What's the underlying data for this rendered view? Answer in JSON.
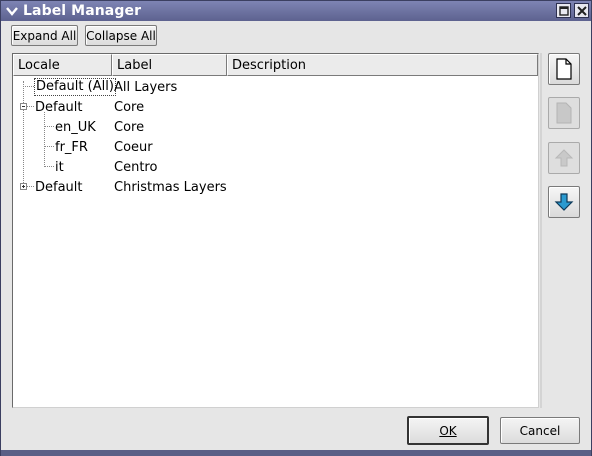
{
  "window": {
    "title": "Label Manager"
  },
  "toolbar": {
    "expand_all": "Expand All",
    "collapse_all": "Collapse All"
  },
  "table": {
    "columns": [
      "Locale",
      "Label",
      "Description"
    ],
    "rows": [
      {
        "locale": "Default (All)",
        "label": "All Layers",
        "description": ""
      },
      {
        "locale": "Default",
        "label": "Core",
        "description": "",
        "expanded": true
      },
      {
        "locale": "en_UK",
        "label": "Core",
        "description": ""
      },
      {
        "locale": "fr_FR",
        "label": "Coeur",
        "description": ""
      },
      {
        "locale": "it",
        "label": "Centro",
        "description": ""
      },
      {
        "locale": "Default",
        "label": "Christmas Layers",
        "description": "",
        "expanded": false
      }
    ]
  },
  "side_buttons": {
    "new": "new-document-icon",
    "delete": "document-icon",
    "move_up": "arrow-up-icon",
    "move_down": "arrow-down-icon"
  },
  "dialog": {
    "ok": "OK",
    "cancel": "Cancel"
  },
  "colors": {
    "titlebar": "#5d628f",
    "accent_arrow": "#2a9ad0"
  }
}
